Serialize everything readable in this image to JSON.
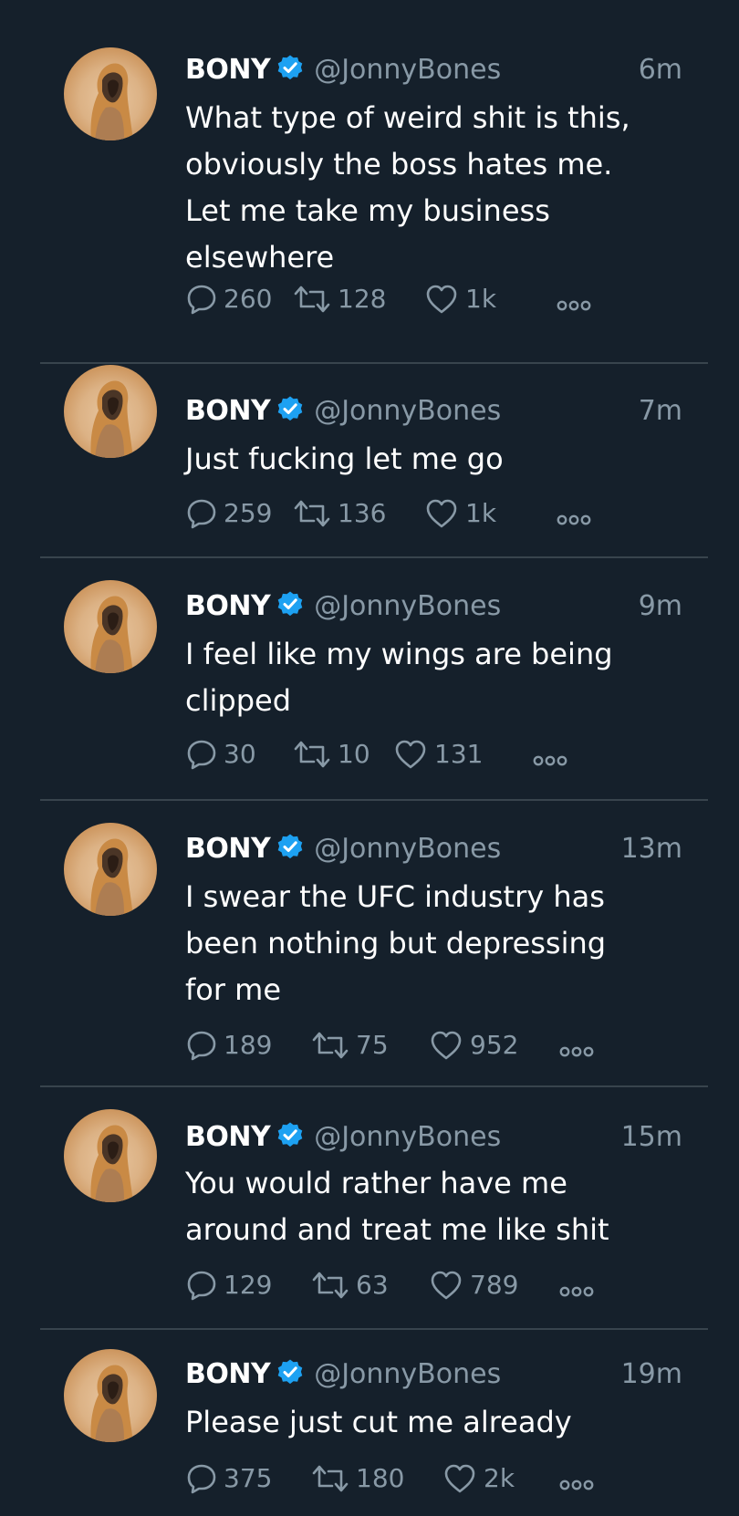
{
  "colors": {
    "background": "#15202b",
    "divider": "#38444d",
    "text_primary": "#ffffff",
    "text_secondary": "#8899a6",
    "verified": "#1da1f2"
  },
  "tweets": [
    {
      "name": "BONY",
      "handle": "@JonnyBones",
      "time": "6m",
      "text": "What type of weird shit is this,\nobviously the boss hates me.\nLet me take my business\nelsewhere",
      "replies": "260",
      "retweets": "128",
      "likes": "1k"
    },
    {
      "name": "BONY",
      "handle": "@JonnyBones",
      "time": "7m",
      "text": "Just fucking let me go",
      "replies": "259",
      "retweets": "136",
      "likes": "1k"
    },
    {
      "name": "BONY",
      "handle": "@JonnyBones",
      "time": "9m",
      "text": "I feel like my wings are being\nclipped",
      "replies": "30",
      "retweets": "10",
      "likes": "131"
    },
    {
      "name": "BONY",
      "handle": "@JonnyBones",
      "time": "13m",
      "text": "I swear the UFC industry has\nbeen nothing but depressing\nfor me",
      "replies": "189",
      "retweets": "75",
      "likes": "952"
    },
    {
      "name": "BONY",
      "handle": "@JonnyBones",
      "time": "15m",
      "text": "You would rather have me\naround and treat me like shit",
      "replies": "129",
      "retweets": "63",
      "likes": "789"
    },
    {
      "name": "BONY",
      "handle": "@JonnyBones",
      "time": "19m",
      "text": "Please just cut me already",
      "replies": "375",
      "retweets": "180",
      "likes": "2k"
    }
  ]
}
